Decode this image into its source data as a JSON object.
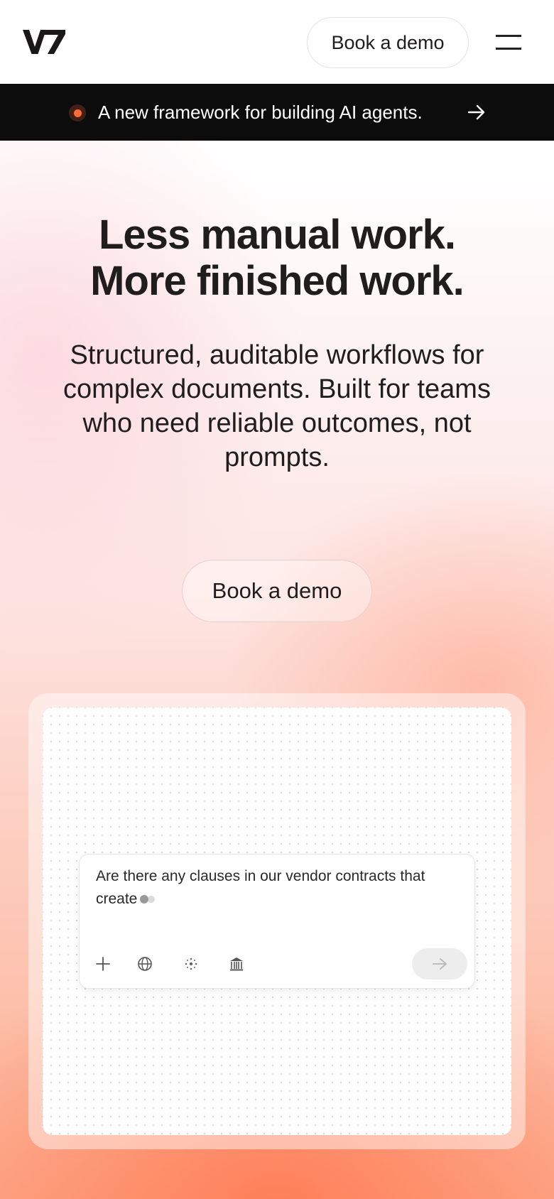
{
  "header": {
    "logo_text": "V7",
    "book_demo_label": "Book a demo",
    "menu_icon": "hamburger-menu-icon"
  },
  "banner": {
    "text": "A new framework for building AI agents.",
    "dot_color": "#ff6b35",
    "arrow_icon": "arrow-right-icon"
  },
  "hero": {
    "title_line1": "Less manual work.",
    "title_line2": "More finished work.",
    "subtitle": "Structured, auditable workflows for complex documents. Built for teams who need reliable outcomes, not prompts.",
    "cta_label": "Book a demo"
  },
  "demo": {
    "prompt_text": "Are there any clauses in our vendor contracts that create",
    "tools": [
      "plus-icon",
      "globe-icon",
      "sparkle-dots-icon",
      "library-icon"
    ],
    "send_icon": "arrow-right-icon"
  },
  "colors": {
    "banner_bg": "#0d0c0d",
    "accent": "#ff6b35",
    "text": "#1f1d1d"
  }
}
